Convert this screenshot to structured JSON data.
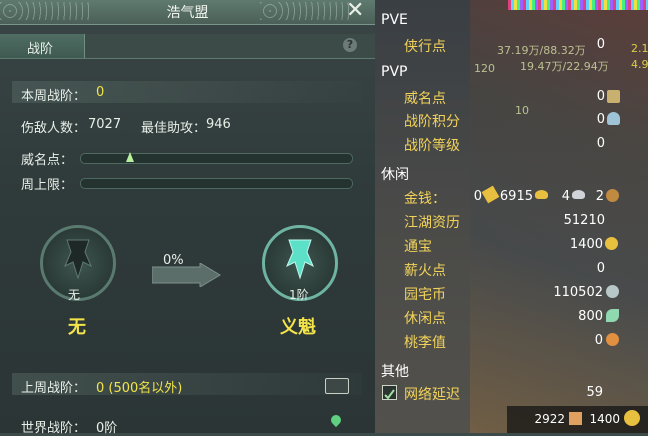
{
  "window": {
    "title": "浩气盟"
  },
  "tab": {
    "label": "战阶",
    "help": "?"
  },
  "stats": {
    "week_rank_label": "本周战阶：",
    "week_rank_value": "0",
    "kills_label": "伤敌人数：",
    "kills_value": "7027",
    "assists_label": "最佳助攻：",
    "assists_value": "946",
    "prestige_label": "威名点：",
    "cap_label": "周上限："
  },
  "rank": {
    "current_caption": "无",
    "current_title": "无",
    "progress_text": "0%",
    "progress": 0,
    "next_caption": "1阶",
    "next_title": "义魁"
  },
  "footer": {
    "last_week_label": "上周战阶：",
    "last_week_value": "0 (500名以外)",
    "world_label": "世界战阶：",
    "world_value": "0阶"
  },
  "currency_panel": {
    "pve_header": "PVE",
    "xiaxing_label": "侠行点",
    "xiaxing_value": "0",
    "pvp_header": "PVP",
    "weiming_label": "威名点",
    "weiming_value": "0",
    "zhanjie_jifen_label": "战阶积分",
    "zhanjie_jifen_value": "0",
    "zhanjie_dengji_label": "战阶等级",
    "zhanjie_dengji_value": "0",
    "leisure_header": "休闲",
    "money_label": "金钱：",
    "money_zhuan": "0",
    "money_jin": "6915",
    "money_yin": "4",
    "money_tong": "2",
    "jianghu_label": "江湖资历",
    "jianghu_value": "51210",
    "tongbao_label": "通宝",
    "tongbao_value": "1400",
    "xinhuo_label": "薪火点",
    "xinhuo_value": "0",
    "yuanzhai_label": "园宅币",
    "yuanzhai_value": "110502",
    "xiuxian_label": "休闲点",
    "xiuxian_value": "800",
    "taoli_label": "桃李值",
    "taoli_value": "0",
    "other_header": "其他",
    "latency_label": "网络延迟",
    "latency_value": "59"
  },
  "hud": {
    "hp_text": "37.19万/88.32万",
    "mp_text": "19.47万/22.94万",
    "level": "120",
    "floor_num": "10",
    "side_a": "2.1",
    "side_b": "4.9"
  },
  "bottom_bar": {
    "value_a": "2922",
    "value_b": "1400"
  }
}
